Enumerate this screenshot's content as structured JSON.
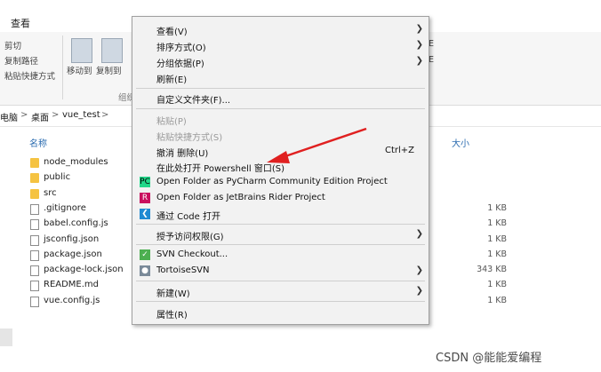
{
  "ribbon": {
    "tab_view": "查看",
    "cut": "剪切",
    "copy_path": "复制路径",
    "paste_shortcut": "粘贴快捷方式",
    "move_to": "移动到",
    "copy_to": "复制到",
    "group_org": "组织",
    "frag1": "E",
    "frag2": "E"
  },
  "breadcrumb": {
    "items": [
      "电脑",
      "桌面",
      "vue_test"
    ],
    "separator": ">"
  },
  "columns": {
    "name": "名称",
    "size": "大小"
  },
  "files": [
    {
      "name": "node_modules",
      "type": "folder",
      "size": ""
    },
    {
      "name": "public",
      "type": "folder",
      "size": ""
    },
    {
      "name": "src",
      "type": "folder",
      "size": ""
    },
    {
      "name": ".gitignore",
      "type": "file",
      "size": "1 KB"
    },
    {
      "name": "babel.config.js",
      "type": "file",
      "size": "1 KB"
    },
    {
      "name": "jsconfig.json",
      "type": "file",
      "size": "1 KB"
    },
    {
      "name": "package.json",
      "type": "file",
      "size": "1 KB"
    },
    {
      "name": "package-lock.json",
      "type": "file",
      "size": "343 KB"
    },
    {
      "name": "README.md",
      "type": "file",
      "size": "1 KB"
    },
    {
      "name": "vue.config.js",
      "type": "file",
      "size": "1 KB"
    }
  ],
  "menu": {
    "view": "查看(V)",
    "sort": "排序方式(O)",
    "group": "分组依据(P)",
    "refresh": "刷新(E)",
    "customize": "自定义文件夹(F)...",
    "paste": "粘贴(P)",
    "paste_shortcut": "粘贴快捷方式(S)",
    "undo_delete": "撤消 删除(U)",
    "undo_shortcut": "Ctrl+Z",
    "powershell": "在此处打开 Powershell 窗口(S)",
    "pycharm": "Open Folder as PyCharm Community Edition Project",
    "rider": "Open Folder as JetBrains Rider Project",
    "vscode": "通过 Code 打开",
    "grant_access": "授予访问权限(G)",
    "svn_checkout": "SVN Checkout...",
    "tortoise": "TortoiseSVN",
    "new": "新建(W)",
    "properties": "属性(R)"
  },
  "colors": {
    "accent": "#2b6cb0",
    "arrow": "#e02020",
    "folder": "#f5c342"
  },
  "watermark": "CSDN @能能爱编程"
}
